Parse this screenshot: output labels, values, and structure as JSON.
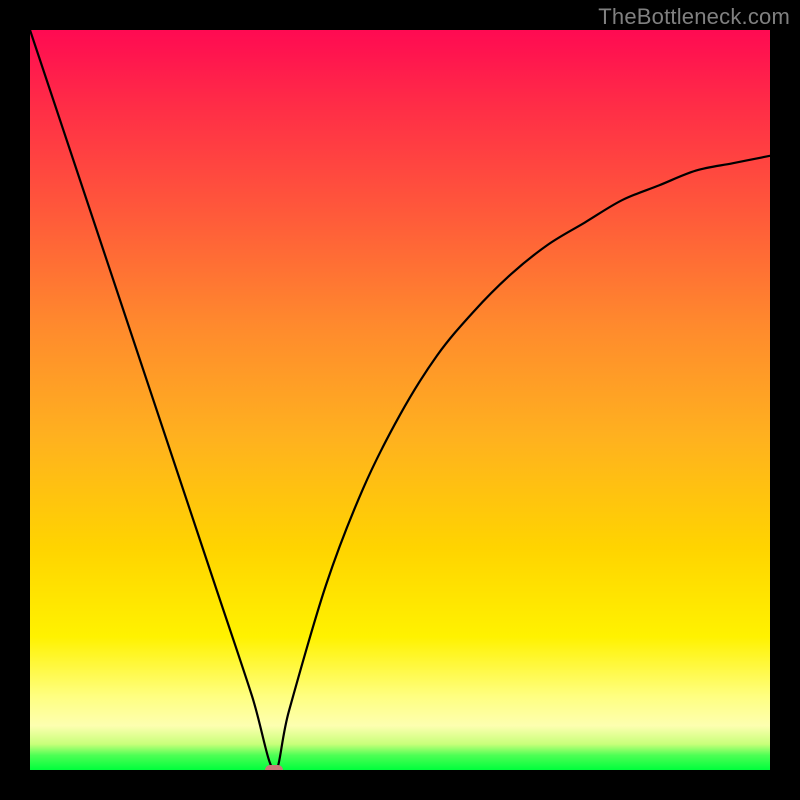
{
  "watermark": "TheBottleneck.com",
  "chart_data": {
    "type": "line",
    "title": "",
    "xlabel": "",
    "ylabel": "",
    "xlim": [
      0,
      100
    ],
    "ylim": [
      0,
      100
    ],
    "grid": false,
    "legend": false,
    "series": [
      {
        "name": "bottleneck-curve",
        "x": [
          0,
          5,
          10,
          15,
          20,
          25,
          30,
          33,
          35,
          40,
          45,
          50,
          55,
          60,
          65,
          70,
          75,
          80,
          85,
          90,
          95,
          100
        ],
        "y": [
          100,
          85,
          70,
          55,
          40,
          25,
          10,
          0,
          8,
          25,
          38,
          48,
          56,
          62,
          67,
          71,
          74,
          77,
          79,
          81,
          82,
          83
        ]
      }
    ],
    "minimum_marker": {
      "x": 33,
      "y": 0,
      "color": "#c97878"
    },
    "background_gradient": {
      "orientation": "vertical",
      "stops": [
        {
          "pos": 0.0,
          "color": "#ff0a52"
        },
        {
          "pos": 0.25,
          "color": "#ff5a3a"
        },
        {
          "pos": 0.55,
          "color": "#ffb11f"
        },
        {
          "pos": 0.82,
          "color": "#fff200"
        },
        {
          "pos": 0.94,
          "color": "#fdffb0"
        },
        {
          "pos": 1.0,
          "color": "#00ff3c"
        }
      ]
    }
  }
}
